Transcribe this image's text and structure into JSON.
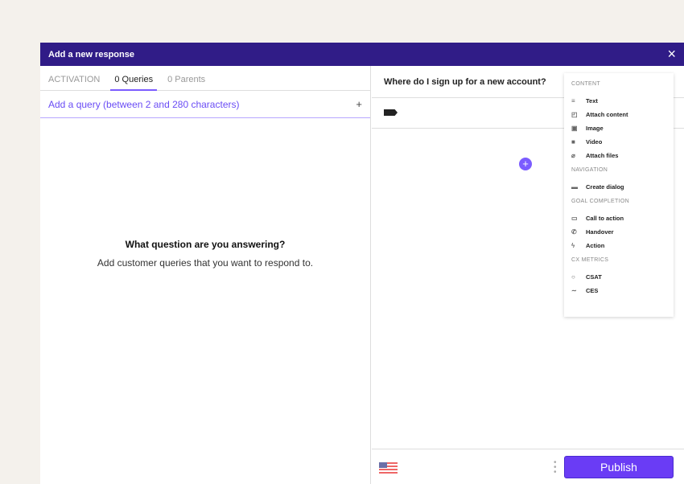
{
  "header": {
    "title": "Add a new response",
    "close": "×"
  },
  "tabs": [
    {
      "label": "ACTIVATION"
    },
    {
      "label": "0 Queries"
    },
    {
      "label": "0 Parents"
    }
  ],
  "query": {
    "placeholder": "Add a query (between 2 and 280 characters)",
    "add": "+"
  },
  "empty": {
    "title": "What question are you answering?",
    "subtitle": "Add customer queries that you want to respond to."
  },
  "right": {
    "question": "Where do I sign up for a new account?",
    "add": "+"
  },
  "menu": {
    "sections": [
      {
        "title": "CONTENT",
        "items": [
          {
            "label": "Text",
            "icon": "≡"
          },
          {
            "label": "Attach content",
            "icon": "◰"
          },
          {
            "label": "Image",
            "icon": "▣"
          },
          {
            "label": "Video",
            "icon": "■"
          },
          {
            "label": "Attach files",
            "icon": "⌀"
          }
        ]
      },
      {
        "title": "NAVIGATION",
        "items": [
          {
            "label": "Create dialog",
            "icon": "▬"
          }
        ]
      },
      {
        "title": "GOAL COMPLETION",
        "items": [
          {
            "label": "Call to action",
            "icon": "▭"
          },
          {
            "label": "Handover",
            "icon": "✆"
          },
          {
            "label": "Action",
            "icon": "ϟ"
          }
        ]
      },
      {
        "title": "CX METRICS",
        "items": [
          {
            "label": "CSAT",
            "icon": "○"
          },
          {
            "label": "CES",
            "icon": "∼"
          }
        ]
      }
    ]
  },
  "footer": {
    "publish": "Publish",
    "language": "en-US flag"
  }
}
